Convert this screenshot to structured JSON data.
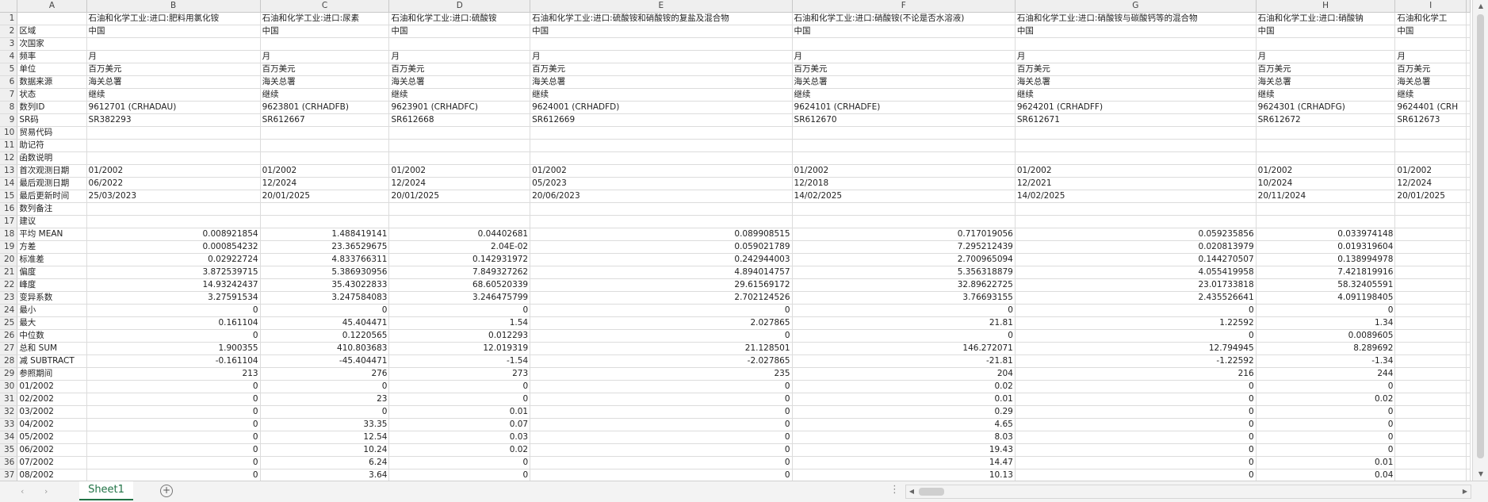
{
  "columns": [
    "A",
    "B",
    "C",
    "D",
    "E",
    "F",
    "G",
    "H",
    "I"
  ],
  "rows": [
    {
      "n": "1",
      "cells": [
        "",
        "石油和化学工业:进口:肥料用氯化铵",
        "石油和化学工业:进口:尿素",
        "石油和化学工业:进口:硫酸铵",
        "石油和化学工业:进口:硫酸铵和硝酸铵的复盐及混合物",
        "石油和化学工业:进口:硝酸铵(不论是否水溶液)",
        "石油和化学工业:进口:硝酸铵与碳酸钙等的混合物",
        "石油和化学工业:进口:硝酸钠",
        "石油和化学工"
      ]
    },
    {
      "n": "2",
      "cells": [
        "区域",
        "中国",
        "中国",
        "中国",
        "中国",
        "中国",
        "中国",
        "中国",
        "中国"
      ]
    },
    {
      "n": "3",
      "cells": [
        "次国家",
        "",
        "",
        "",
        "",
        "",
        "",
        "",
        ""
      ]
    },
    {
      "n": "4",
      "cells": [
        "频率",
        "月",
        "月",
        "月",
        "月",
        "月",
        "月",
        "月",
        "月"
      ]
    },
    {
      "n": "5",
      "cells": [
        "单位",
        "百万美元",
        "百万美元",
        "百万美元",
        "百万美元",
        "百万美元",
        "百万美元",
        "百万美元",
        "百万美元"
      ]
    },
    {
      "n": "6",
      "cells": [
        "数据来源",
        "海关总署",
        "海关总署",
        "海关总署",
        "海关总署",
        "海关总署",
        "海关总署",
        "海关总署",
        "海关总署"
      ]
    },
    {
      "n": "7",
      "cells": [
        "状态",
        "继续",
        "继续",
        "继续",
        "继续",
        "继续",
        "继续",
        "继续",
        "继续"
      ]
    },
    {
      "n": "8",
      "cells": [
        "数列ID",
        "9612701 (CRHADAU)",
        "9623801 (CRHADFB)",
        "9623901 (CRHADFC)",
        "9624001 (CRHADFD)",
        "9624101 (CRHADFE)",
        "9624201 (CRHADFF)",
        "9624301 (CRHADFG)",
        "9624401 (CRH"
      ]
    },
    {
      "n": "9",
      "cells": [
        "SR码",
        "SR382293",
        "SR612667",
        "SR612668",
        "SR612669",
        "SR612670",
        "SR612671",
        "SR612672",
        "SR612673"
      ]
    },
    {
      "n": "10",
      "cells": [
        "贸易代码",
        "",
        "",
        "",
        "",
        "",
        "",
        "",
        ""
      ]
    },
    {
      "n": "11",
      "cells": [
        "助记符",
        "",
        "",
        "",
        "",
        "",
        "",
        "",
        ""
      ]
    },
    {
      "n": "12",
      "cells": [
        "函数说明",
        "",
        "",
        "",
        "",
        "",
        "",
        "",
        ""
      ]
    },
    {
      "n": "13",
      "cells": [
        "首次观测日期",
        "01/2002",
        "01/2002",
        "01/2002",
        "01/2002",
        "01/2002",
        "01/2002",
        "01/2002",
        "01/2002"
      ]
    },
    {
      "n": "14",
      "cells": [
        "最后观测日期",
        "06/2022",
        "12/2024",
        "12/2024",
        "05/2023",
        "12/2018",
        "12/2021",
        "10/2024",
        "12/2024"
      ]
    },
    {
      "n": "15",
      "cells": [
        "最后更新时间",
        "25/03/2023",
        "20/01/2025",
        "20/01/2025",
        "20/06/2023",
        "14/02/2025",
        "14/02/2025",
        "20/11/2024",
        "20/01/2025"
      ]
    },
    {
      "n": "16",
      "cells": [
        "数列备注",
        "",
        "",
        "",
        "",
        "",
        "",
        "",
        ""
      ]
    },
    {
      "n": "17",
      "cells": [
        "建议",
        "",
        "",
        "",
        "",
        "",
        "",
        "",
        ""
      ]
    },
    {
      "n": "18",
      "cells": [
        "平均 MEAN",
        "0.008921854",
        "1.488419141",
        "0.04402681",
        "0.089908515",
        "0.717019056",
        "0.059235856",
        "0.033974148",
        ""
      ]
    },
    {
      "n": "19",
      "cells": [
        "方差",
        "0.000854232",
        "23.36529675",
        "2.04E-02",
        "0.059021789",
        "7.295212439",
        "0.020813979",
        "0.019319604",
        ""
      ]
    },
    {
      "n": "20",
      "cells": [
        "标准差",
        "0.02922724",
        "4.833766311",
        "0.142931972",
        "0.242944003",
        "2.700965094",
        "0.144270507",
        "0.138994978",
        ""
      ]
    },
    {
      "n": "21",
      "cells": [
        "偏度",
        "3.872539715",
        "5.386930956",
        "7.849327262",
        "4.894014757",
        "5.356318879",
        "4.055419958",
        "7.421819916",
        ""
      ]
    },
    {
      "n": "22",
      "cells": [
        "峰度",
        "14.93242437",
        "35.43022833",
        "68.60520339",
        "29.61569172",
        "32.89622725",
        "23.01733818",
        "58.32405591",
        ""
      ]
    },
    {
      "n": "23",
      "cells": [
        "变异系数",
        "3.27591534",
        "3.247584083",
        "3.246475799",
        "2.702124526",
        "3.76693155",
        "2.435526641",
        "4.091198405",
        ""
      ]
    },
    {
      "n": "24",
      "cells": [
        "最小",
        "0",
        "0",
        "0",
        "0",
        "0",
        "0",
        "0",
        ""
      ]
    },
    {
      "n": "25",
      "cells": [
        "最大",
        "0.161104",
        "45.404471",
        "1.54",
        "2.027865",
        "21.81",
        "1.22592",
        "1.34",
        ""
      ]
    },
    {
      "n": "26",
      "cells": [
        "中位数",
        "0",
        "0.1220565",
        "0.012293",
        "0",
        "0",
        "0",
        "0.0089605",
        ""
      ]
    },
    {
      "n": "27",
      "cells": [
        "总和 SUM",
        "1.900355",
        "410.803683",
        "12.019319",
        "21.128501",
        "146.272071",
        "12.794945",
        "8.289692",
        ""
      ]
    },
    {
      "n": "28",
      "cells": [
        "减 SUBTRACT",
        "-0.161104",
        "-45.404471",
        "-1.54",
        "-2.027865",
        "-21.81",
        "-1.22592",
        "-1.34",
        ""
      ]
    },
    {
      "n": "29",
      "cells": [
        "参照期间",
        "213",
        "276",
        "273",
        "235",
        "204",
        "216",
        "244",
        ""
      ]
    },
    {
      "n": "30",
      "cells": [
        "01/2002",
        "0",
        "0",
        "0",
        "0",
        "0.02",
        "0",
        "0",
        ""
      ]
    },
    {
      "n": "31",
      "cells": [
        "02/2002",
        "0",
        "23",
        "0",
        "0",
        "0.01",
        "0",
        "0.02",
        ""
      ]
    },
    {
      "n": "32",
      "cells": [
        "03/2002",
        "0",
        "0",
        "0.01",
        "0",
        "0.29",
        "0",
        "0",
        ""
      ]
    },
    {
      "n": "33",
      "cells": [
        "04/2002",
        "0",
        "33.35",
        "0.07",
        "0",
        "4.65",
        "0",
        "0",
        ""
      ]
    },
    {
      "n": "34",
      "cells": [
        "05/2002",
        "0",
        "12.54",
        "0.03",
        "0",
        "8.03",
        "0",
        "0",
        ""
      ]
    },
    {
      "n": "35",
      "cells": [
        "06/2002",
        "0",
        "10.24",
        "0.02",
        "0",
        "19.43",
        "0",
        "0",
        ""
      ]
    },
    {
      "n": "36",
      "cells": [
        "07/2002",
        "0",
        "6.24",
        "0",
        "0",
        "14.47",
        "0",
        "0.01",
        ""
      ]
    },
    {
      "n": "37",
      "cells": [
        "08/2002",
        "0",
        "3.64",
        "0",
        "0",
        "10.13",
        "0",
        "0.04",
        ""
      ]
    }
  ],
  "footer": {
    "sheet_tab": "Sheet1",
    "add_sheet": "+",
    "nav_prev": "‹",
    "nav_next": "›",
    "dots": "⋮",
    "scroll_left": "◀",
    "scroll_right": "▶",
    "scroll_up": "▲",
    "scroll_down": "▼"
  }
}
